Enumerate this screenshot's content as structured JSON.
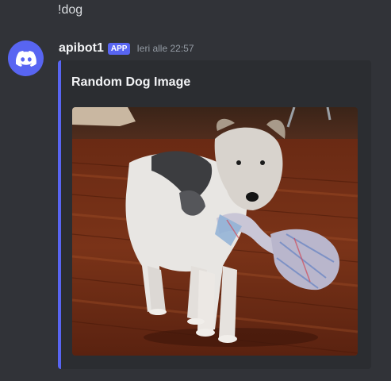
{
  "previous_message": {
    "text": "!dog"
  },
  "message": {
    "author": "apibot1",
    "badge": "APP",
    "timestamp": "Ieri alle 22:57",
    "avatar_icon": "discord-logo-icon",
    "avatar_color": "#5865f2"
  },
  "embed": {
    "title": "Random Dog Image",
    "accent_color": "#5865f2",
    "image": {
      "description": "photo"
    }
  }
}
